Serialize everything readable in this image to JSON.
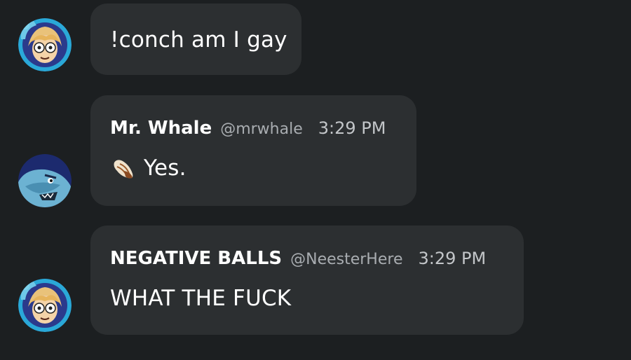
{
  "messages": [
    {
      "text": "!conch am I gay",
      "avatar": "cartoon-boy-avatar-icon"
    },
    {
      "author": "Mr. Whale",
      "handle": "@mrwhale",
      "time": "3:29 PM",
      "text": "Yes.",
      "icon": "conch-shell-icon",
      "avatar": "blue-whale-avatar-icon"
    },
    {
      "author": "NEGATIVE BALLS",
      "handle": "@NeesterHere",
      "time": "3:29 PM",
      "text": "WHAT THE FUCK",
      "avatar": "cartoon-boy-avatar-icon"
    }
  ],
  "colors": {
    "background": "#1c1f21",
    "bubble": "#2c2f31",
    "handle": "#a9adb1",
    "avatar_ring": "#2aa8d8"
  }
}
